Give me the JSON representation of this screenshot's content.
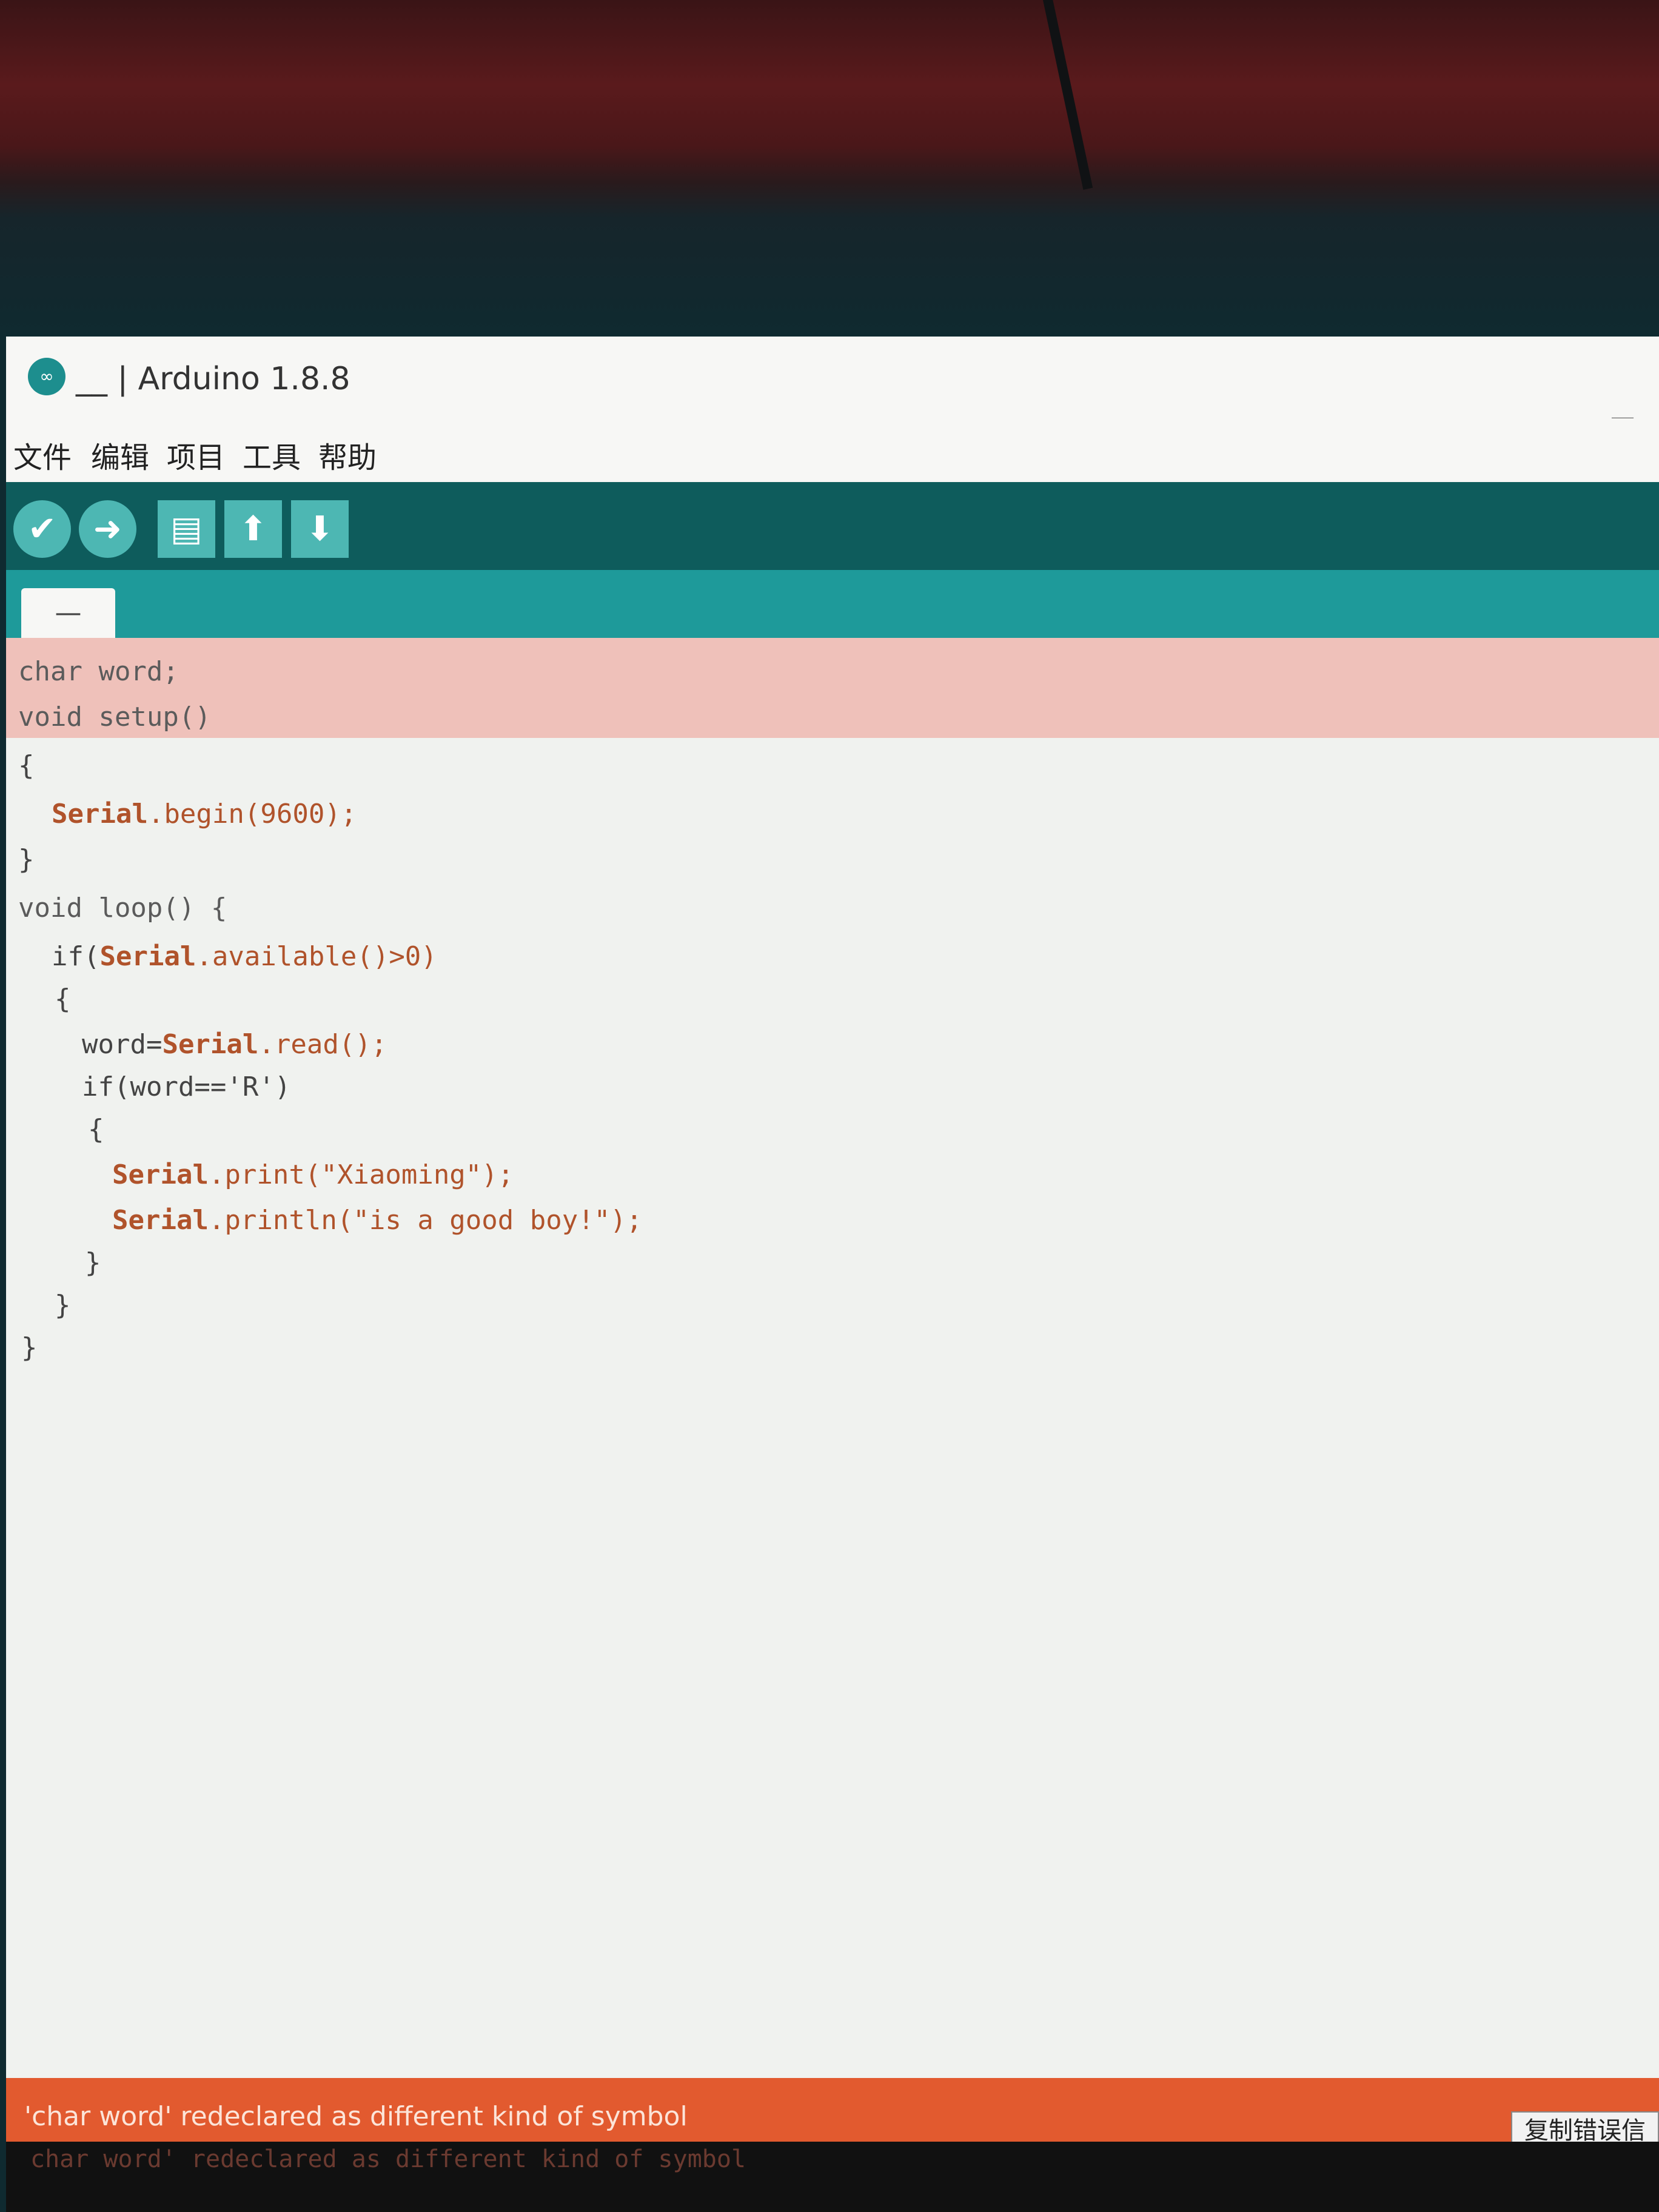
{
  "window": {
    "title": "__ | Arduino 1.8.8",
    "minimize_glyph": "—"
  },
  "menu": [
    "文件",
    "编辑",
    "项目",
    "工具",
    "帮助"
  ],
  "toolbar": {
    "verify_glyph": "✔",
    "upload_glyph": "➜",
    "new_glyph": "▤",
    "open_glyph": "⬆",
    "save_glyph": "⬇"
  },
  "tab": {
    "label": "—"
  },
  "code": {
    "l1": "char word;",
    "l2": "void setup()",
    "l3": "{",
    "l4_cls": "Serial",
    "l4_rest": ".begin(9600);",
    "l5": "}",
    "l6": "void loop() {",
    "l7_a": "if(",
    "l7_cls": "Serial",
    "l7_b": ".available()>0)",
    "l8": "{",
    "l9_a": "word=",
    "l9_cls": "Serial",
    "l9_b": ".read();",
    "l10": "if(word=='R')",
    "l11": "{",
    "l12_cls": "Serial",
    "l12_b": ".print(\"Xiaoming\");",
    "l13_cls": "Serial",
    "l13_b": ".println(\"is a good boy!\");",
    "l14": "}",
    "l15": "}",
    "l16": "}"
  },
  "status": {
    "message": "'char word' redeclared as different kind of symbol",
    "copy_button": "复制错误信"
  },
  "console": {
    "text": "char word' redeclared as different kind of symbol"
  },
  "colors": {
    "toolbar": "#0e5c5c",
    "tab_strip": "#1e9a9a",
    "error_bar": "#e25a2f",
    "error_highlight": "#efc1ba"
  }
}
